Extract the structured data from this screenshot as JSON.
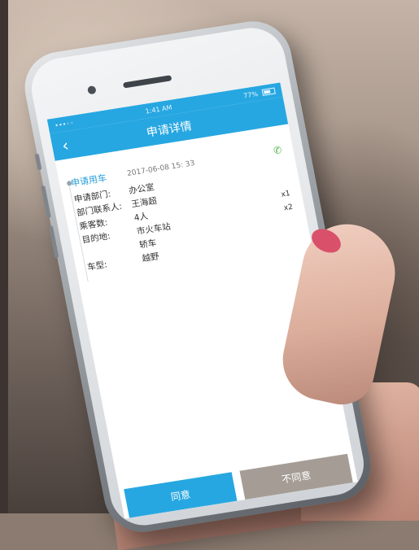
{
  "status": {
    "time": "1:41 AM",
    "battery": "77%",
    "carrier": "•••◦◦"
  },
  "nav": {
    "title": "申请详情",
    "back_icon": "chevron-left-icon"
  },
  "request": {
    "type": "申请用车",
    "time": "2017-06-08 15: 33",
    "phone_icon": "phone-icon",
    "fields": [
      {
        "label": "申请部门:",
        "value": "办公室",
        "qty": ""
      },
      {
        "label": "部门联系人:",
        "value": "王海超",
        "qty": ""
      },
      {
        "label": "乘客数:",
        "value": "4人",
        "qty": "x1"
      },
      {
        "label": "目的地:",
        "value": "市火车站",
        "qty": "x2"
      },
      {
        "label": "",
        "value": "轿车",
        "qty": ""
      },
      {
        "label": "车型:",
        "value": "越野",
        "qty": ""
      }
    ]
  },
  "actions": {
    "agree": "同意",
    "disagree": "不同意"
  },
  "colors": {
    "accent": "#27a7e1",
    "disagree_bg": "#a59d95",
    "nail": "#d9506a"
  }
}
